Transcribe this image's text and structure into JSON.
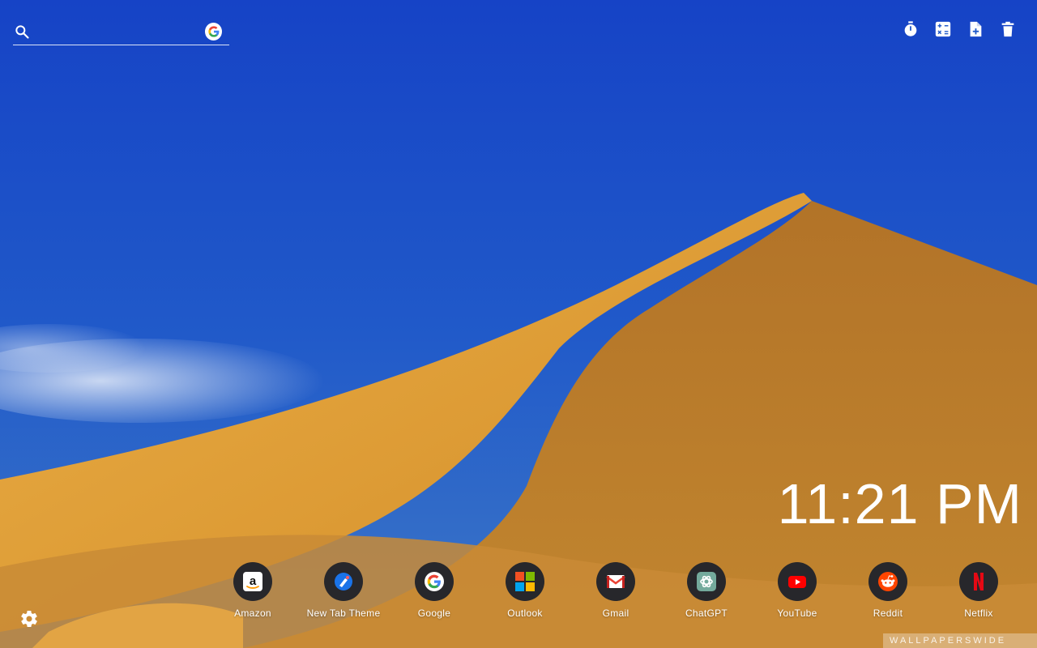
{
  "search": {
    "value": "",
    "placeholder": "",
    "search_icon": "search-icon",
    "engine_icon": "google-g-icon"
  },
  "toolbar": {
    "items": [
      {
        "icon": "timer-icon"
      },
      {
        "icon": "calculator-icon"
      },
      {
        "icon": "note-add-icon"
      },
      {
        "icon": "trash-icon"
      }
    ]
  },
  "clock": {
    "time": "11:21 PM"
  },
  "shortcuts": [
    {
      "label": "Amazon",
      "icon": "amazon-icon"
    },
    {
      "label": "New Tab Theme",
      "icon": "new-tab-theme-icon"
    },
    {
      "label": "Google",
      "icon": "google-icon"
    },
    {
      "label": "Outlook",
      "icon": "outlook-icon"
    },
    {
      "label": "Gmail",
      "icon": "gmail-icon"
    },
    {
      "label": "ChatGPT",
      "icon": "chatgpt-icon"
    },
    {
      "label": "YouTube",
      "icon": "youtube-icon"
    },
    {
      "label": "Reddit",
      "icon": "reddit-icon"
    },
    {
      "label": "Netflix",
      "icon": "netflix-icon"
    }
  ],
  "settings": {
    "icon": "gear-icon"
  },
  "wallpaper": {
    "sky_color": "#1d55cc",
    "sand_light": "#e0a13a",
    "sand_shadow": "#b9782a",
    "watermark": "WALLPAPERSWIDE"
  }
}
